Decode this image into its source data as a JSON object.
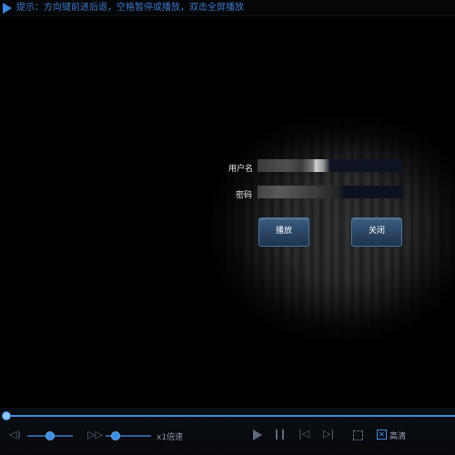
{
  "topbar": {
    "hint": "提示：方向键前进后退，空格暂停或播放，双击全屏播放"
  },
  "login": {
    "username_label": "用户名",
    "password_label": "密码",
    "play_button": "播放",
    "close_button": "关闭"
  },
  "controls": {
    "progress": 0.0,
    "volume": 0.5,
    "speed_level": 0.2,
    "speed_label": "x1倍速",
    "hq_label": "高清",
    "hq_checked": true
  },
  "colors": {
    "accent": "#3e8ad6",
    "hint_text": "#3b78c8"
  }
}
